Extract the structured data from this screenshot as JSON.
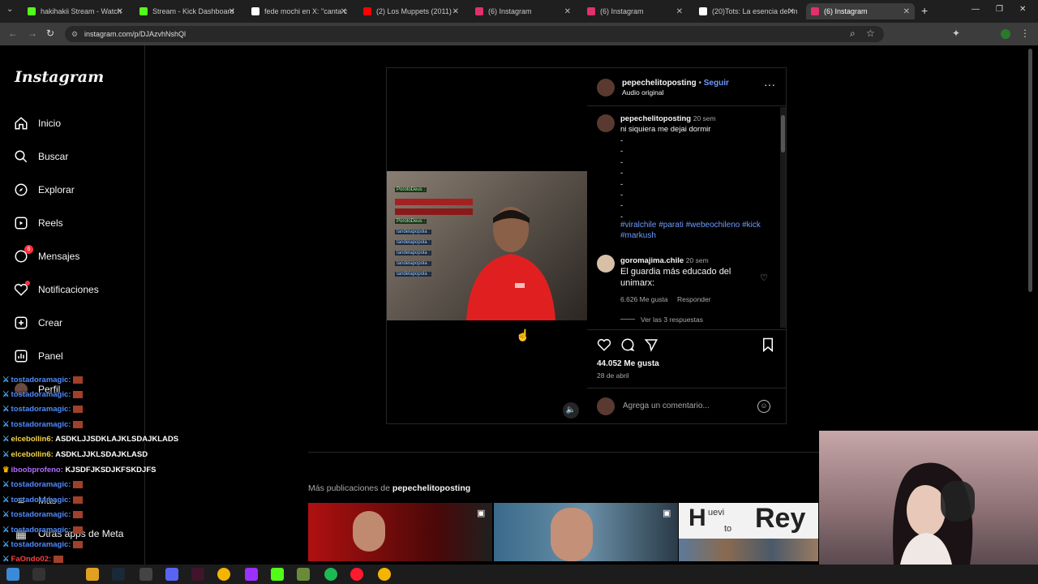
{
  "browser": {
    "tabs": [
      {
        "title": "hakihakii Stream - Watch",
        "color": "#53fc18"
      },
      {
        "title": "Stream - Kick Dashboard",
        "color": "#53fc18"
      },
      {
        "title": "fede mochi en X: \"canta c",
        "color": "#ffffff"
      },
      {
        "title": "(2) Los Muppets (2011) -",
        "color": "#ff0000"
      },
      {
        "title": "(6) Instagram",
        "color": "#e1306c"
      },
      {
        "title": "(6) Instagram",
        "color": "#e1306c"
      },
      {
        "title": "(20)Tots: La esencia del m",
        "color": "#ffffff"
      },
      {
        "title": "(6) Instagram",
        "color": "#e1306c"
      }
    ],
    "url": "instagram.com/p/DJAzvhNshQl"
  },
  "sidebar": {
    "logo": "Instagram",
    "items": [
      {
        "label": "Inicio",
        "icon": "home-icon"
      },
      {
        "label": "Buscar",
        "icon": "search-icon"
      },
      {
        "label": "Explorar",
        "icon": "compass-icon"
      },
      {
        "label": "Reels",
        "icon": "reels-icon"
      },
      {
        "label": "Mensajes",
        "icon": "messenger-icon",
        "badge": "6"
      },
      {
        "label": "Notificaciones",
        "icon": "heart-icon"
      },
      {
        "label": "Crear",
        "icon": "plus-icon"
      },
      {
        "label": "Panel",
        "icon": "chart-icon"
      },
      {
        "label": "Perfil",
        "icon": "avatar-icon"
      },
      {
        "label": "Más",
        "icon": "menu-icon"
      },
      {
        "label": "Otras apps de Meta",
        "icon": "grid-icon"
      }
    ]
  },
  "chat": [
    {
      "user": "tostadoramagic:",
      "color": "#4f8cff",
      "msg": ""
    },
    {
      "user": "tostadoramagic:",
      "color": "#4f8cff",
      "msg": ""
    },
    {
      "user": "tostadoramagic:",
      "color": "#4f8cff",
      "msg": ""
    },
    {
      "user": "tostadoramagic:",
      "color": "#4f8cff",
      "msg": ""
    },
    {
      "user": "elcebollin6:",
      "color": "#f5d547",
      "msg": "ASDKLJJSDKLAJKLSDAJKLADS"
    },
    {
      "user": "elcebollin6:",
      "color": "#f5d547",
      "msg": "ASDKLJJKLSDAJKLASD"
    },
    {
      "user": "iboobprofeno:",
      "color": "#b06cff",
      "msg": "KJSDFJKSDJKFSKDJFS"
    },
    {
      "user": "tostadoramagic:",
      "color": "#4f8cff",
      "msg": ""
    },
    {
      "user": "tostadoramagic:",
      "color": "#4f8cff",
      "msg": ""
    },
    {
      "user": "tostadoramagic:",
      "color": "#4f8cff",
      "msg": ""
    },
    {
      "user": "tostadoramagic:",
      "color": "#4f8cff",
      "msg": ""
    },
    {
      "user": "tostadoramagic:",
      "color": "#4f8cff",
      "msg": ""
    },
    {
      "user": "FaOndo02:",
      "color": "#ff4040",
      "msg": ""
    },
    {
      "user": "tostadoramagic:",
      "color": "#4f8cff",
      "msg": ""
    }
  ],
  "post": {
    "username": "pepechelitoposting",
    "follow": "Seguir",
    "audio": "Audio original",
    "caption_time": "20 sem",
    "caption": "ni siquiera me dejai dormir",
    "caption_dashes": [
      "-",
      "-",
      "-",
      "-",
      "-",
      "-",
      "-",
      "-"
    ],
    "hashtags_line1": "#viralchile #parati #webeochileno #kick",
    "hashtags_line2": "#markush",
    "comment": {
      "user": "goromajima.chile",
      "time": "20 sem",
      "text_line1": "El guardia más educado del",
      "text_line2": "unimarx:",
      "likes": "6.626 Me gusta",
      "reply": "Responder",
      "view_replies": "Ver las 3 respuestas"
    },
    "likes": "44.052 Me gusta",
    "date": "28 de abril",
    "comment_placeholder": "Agrega un comentario...",
    "stream_chat": [
      "PorotoDeus :",
      "",
      "",
      "PorotoDeus :",
      "tandelapopola :",
      "tandelapopola :",
      "tandelapopola :",
      "tandelapopola :",
      "tandelapopola :"
    ]
  },
  "more": {
    "prefix": "Más publicaciones de",
    "user": "pepechelitoposting"
  },
  "thumb3_text": {
    "t1": "H",
    "t2": "uevi",
    "t3": "to",
    "t4": "Rey"
  }
}
